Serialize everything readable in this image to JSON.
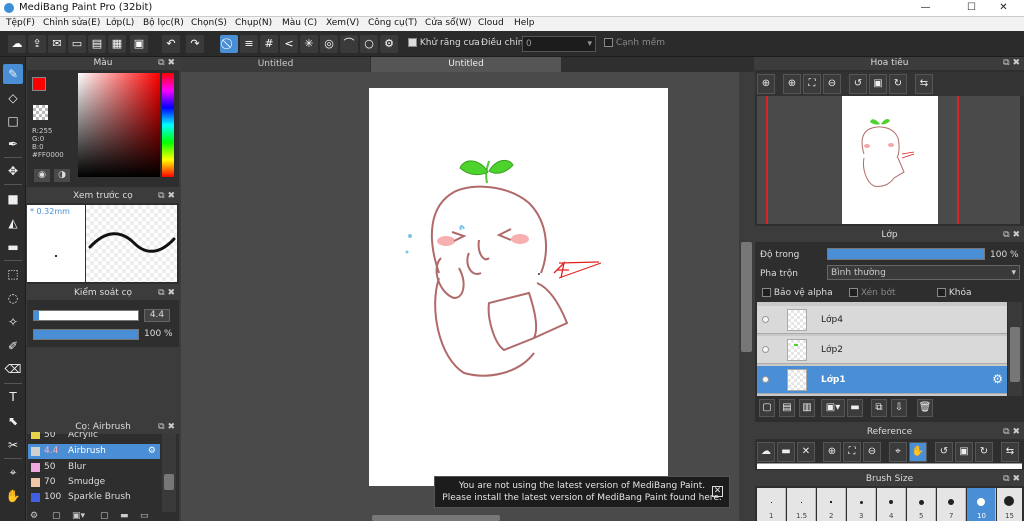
{
  "window": {
    "title": "MediBang Paint Pro (32bit)",
    "minimize": "—",
    "maximize": "☐",
    "close": "✕"
  },
  "menu": [
    "Tệp(F)",
    "Chỉnh sửa(E)",
    "Lớp(L)",
    "Bộ lọc(R)",
    "Chọn(S)",
    "Chụp(N)",
    "Màu (C)",
    "Xem(V)",
    "Công cụ(T)",
    "Cửa sổ(W)",
    "Cloud",
    "Help"
  ],
  "toolbar": {
    "antialias_label": "Khử răng cưa",
    "adjust_label": "Điều chỉnh",
    "adjust_value": "0",
    "edge_label": "Cạnh mềm"
  },
  "color_panel": {
    "title": "Màu",
    "r": "R:255",
    "g": "G:0",
    "b": "B:0",
    "hex": "#FF0000",
    "primary_color": "#ff0000"
  },
  "brush_preview": {
    "title": "Xem trước cọ",
    "size": "* 0.32mm"
  },
  "brush_control": {
    "title": "Kiểm soát cọ",
    "size_value": "4.4",
    "opacity_value": "100 %"
  },
  "brush_list": {
    "title": "Cọ: Airbrush",
    "items": [
      {
        "size": "50",
        "name": "Acrylic",
        "color": "#e8d44a"
      },
      {
        "size": "4.4",
        "name": "Airbrush",
        "color": "#d0d0d0"
      },
      {
        "size": "50",
        "name": "Blur",
        "color": "#f0a8e0"
      },
      {
        "size": "70",
        "name": "Smudge",
        "color": "#f0c8a8"
      },
      {
        "size": "100",
        "name": "Sparkle Brush",
        "color": "#4060e0"
      }
    ]
  },
  "document_tabs": [
    "Untitled",
    "Untitled"
  ],
  "notice": {
    "line1": "You are not using the latest version of MediBang Paint.",
    "line2": "Please install the latest version of MediBang Paint found here."
  },
  "navigator": {
    "title": "Hoa tiêu"
  },
  "layers_panel": {
    "title": "Lớp",
    "opacity_label": "Độ trong",
    "opacity_value": "100 %",
    "blend_label": "Pha trộn",
    "blend_value": "Bình thường",
    "alpha_lock": "Bảo vệ alpha",
    "clip": "Xén bớt",
    "lock": "Khóa",
    "layers": [
      {
        "name": "Lớp4",
        "selected": false
      },
      {
        "name": "Lớp2",
        "selected": false
      },
      {
        "name": "Lớp1",
        "selected": true
      }
    ]
  },
  "reference_panel": {
    "title": "Reference"
  },
  "brush_size_panel": {
    "title": "Brush Size",
    "sizes": [
      "1",
      "1.5",
      "2",
      "3",
      "4",
      "5",
      "7",
      "10",
      "15"
    ]
  }
}
